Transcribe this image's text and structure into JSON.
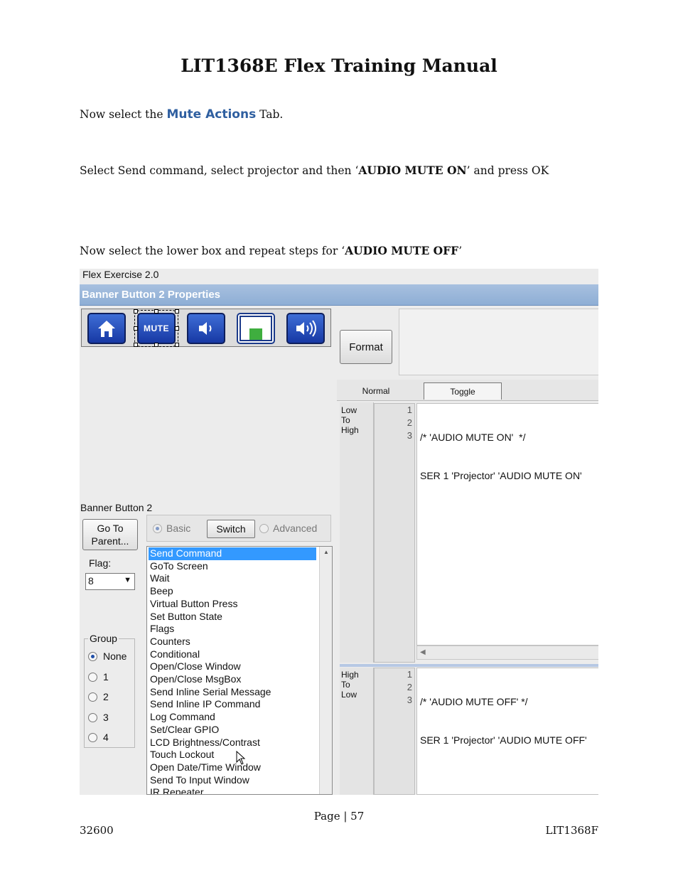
{
  "document": {
    "title": "LIT1368E Flex Training Manual",
    "paragraphs": {
      "p1_before": "Now select the ",
      "p1_accent": "Mute Actions",
      "p1_after": " Tab.",
      "p2_before": "Select Send command, select projector and then ‘",
      "p2_bold": "AUDIO MUTE ON",
      "p2_after": "’ and press OK",
      "p3_before": "Now select the lower box and repeat steps for ‘",
      "p3_bold": "AUDIO MUTE OFF",
      "p3_after": "’"
    },
    "accent_color": "#2f5fa0"
  },
  "screenshot": {
    "window_title": "Flex Exercise 2.0",
    "banner": "Banner Button 2 Properties",
    "tiles": [
      {
        "icon": "home-icon"
      },
      {
        "label": "MUTE",
        "icon": "mute-text-icon"
      },
      {
        "icon": "speaker-low-icon"
      },
      {
        "icon": "level-bar-icon"
      },
      {
        "icon": "speaker-high-icon"
      }
    ],
    "format_label": "Format",
    "tabs": {
      "normal": "Normal",
      "toggle": "Toggle"
    },
    "upper": {
      "condition": [
        "Low",
        "To",
        "High"
      ],
      "line_numbers": [
        "1",
        "2",
        "3"
      ],
      "code": [
        "/* 'AUDIO MUTE ON'  */",
        "SER 1 'Projector' 'AUDIO MUTE ON'",
        ""
      ]
    },
    "lower": {
      "condition": [
        "High",
        "To",
        "Low"
      ],
      "line_numbers": [
        "1",
        "2",
        "3"
      ],
      "code": [
        "/* 'AUDIO MUTE OFF' */",
        "SER 1 'Projector' 'AUDIO MUTE OFF'",
        ""
      ]
    },
    "left_panel": {
      "name_label": "Banner Button 2",
      "goto_line1": "Go To",
      "goto_line2": "Parent...",
      "flag_label": "Flag:",
      "flag_value": "8",
      "group_title": "Group",
      "group_options": [
        "None",
        "1",
        "2",
        "3",
        "4"
      ]
    },
    "mode": {
      "basic": "Basic",
      "switch": "Switch",
      "advanced": "Advanced"
    },
    "actions": [
      "Send Command",
      "GoTo Screen",
      "Wait",
      "Beep",
      "Virtual Button Press",
      "Set Button State",
      "Flags",
      "Counters",
      "Conditional",
      "Open/Close Window",
      "Open/Close MsgBox",
      "Send Inline Serial Message",
      "Send Inline IP Command",
      "Log Command",
      "Set/Clear GPIO",
      "LCD Brightness/Contrast",
      "Touch Lockout",
      "Open Date/Time Window",
      "Send To Input Window",
      "IR Repeater"
    ]
  },
  "footer": {
    "page": "Page | 57",
    "left": "32600",
    "right": "LIT1368F"
  }
}
